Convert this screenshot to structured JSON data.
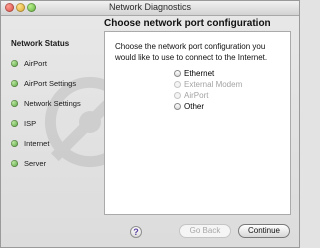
{
  "window": {
    "title": "Network Diagnostics"
  },
  "sidebar": {
    "heading": "Network Status",
    "items": [
      {
        "label": "AirPort"
      },
      {
        "label": "AirPort Settings"
      },
      {
        "label": "Network Settings"
      },
      {
        "label": "ISP"
      },
      {
        "label": "Internet"
      },
      {
        "label": "Server"
      }
    ]
  },
  "main": {
    "title": "Choose network port configuration",
    "prompt": "Choose the network port configuration you would like to use to connect to the Internet.",
    "options": [
      {
        "label": "Ethernet",
        "enabled": true
      },
      {
        "label": "External Modem",
        "enabled": false
      },
      {
        "label": "AirPort",
        "enabled": false
      },
      {
        "label": "Other",
        "enabled": true
      }
    ]
  },
  "footer": {
    "help_label": "?",
    "back_label": "Go Back",
    "continue_label": "Continue"
  },
  "colors": {
    "status_dot": "#5aa83a",
    "disabled_text": "#a3a3a3"
  }
}
